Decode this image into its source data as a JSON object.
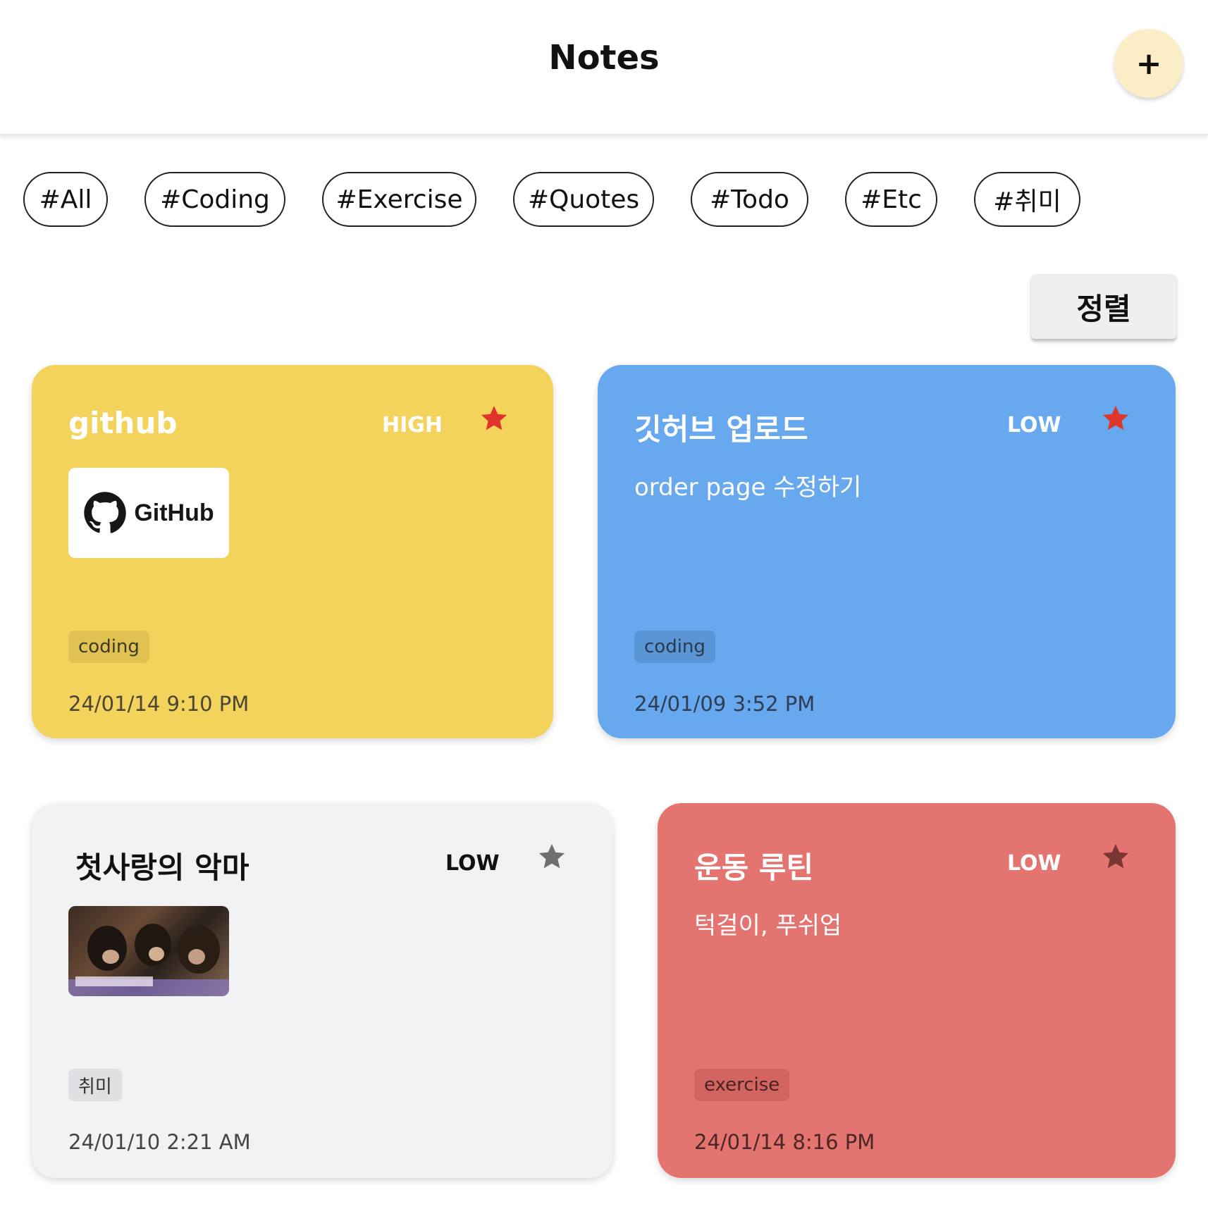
{
  "header": {
    "title": "Notes",
    "add_label": "+"
  },
  "filters": [
    {
      "label": "#All"
    },
    {
      "label": "#Coding"
    },
    {
      "label": "#Exercise"
    },
    {
      "label": "#Quotes"
    },
    {
      "label": "#Todo"
    },
    {
      "label": "#Etc"
    },
    {
      "label": "#취미"
    }
  ],
  "sort_label": "정렬",
  "notes": [
    {
      "title": "github",
      "priority": "HIGH",
      "pinned": true,
      "image": "GitHub logo",
      "image_text": "GitHub",
      "tag": "coding",
      "date": "24/01/14 9:10 PM",
      "color": "#f3d35c"
    },
    {
      "title": "깃허브 업로드",
      "priority": "LOW",
      "pinned": true,
      "body": "order page 수정하기",
      "tag": "coding",
      "date": "24/01/09 3:52 PM",
      "color": "#67a8ee"
    },
    {
      "title": "첫사랑의 악마",
      "priority": "LOW",
      "pinned": false,
      "image": "photo thumbnail",
      "tag": "취미",
      "date": "24/01/10 2:21 AM",
      "color": "#f1f2f4"
    },
    {
      "title": "운동 루틴",
      "priority": "LOW",
      "pinned": false,
      "body": "턱걸이, 푸쉬업",
      "tag": "exercise",
      "date": "24/01/14 8:16 PM",
      "color": "#e47470"
    }
  ],
  "colors": {
    "star_active": "#e0352b",
    "star_inactive_light": "#6f6f6f",
    "star_inactive_red": "#7a3634",
    "add_button_bg": "#fbeec6"
  }
}
